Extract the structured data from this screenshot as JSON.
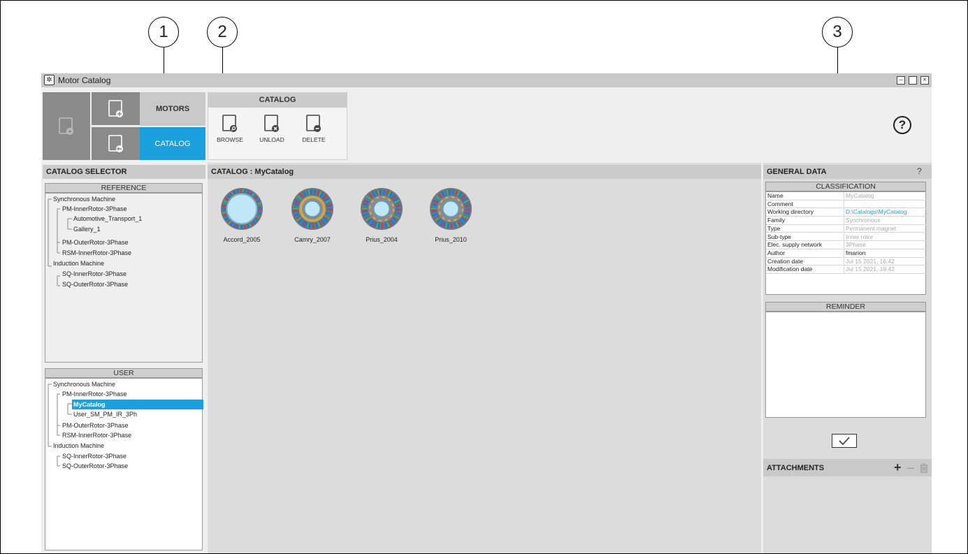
{
  "callouts": [
    "1",
    "2",
    "3"
  ],
  "window": {
    "title": "Motor Catalog",
    "buttons": [
      "minimize",
      "maximize",
      "close"
    ]
  },
  "nav": {
    "motors_label": "MOTORS",
    "catalog_label": "CATALOG"
  },
  "ribbon": {
    "title": "CATALOG",
    "buttons": [
      {
        "label": "BROWSE",
        "icon": "book-browse-icon"
      },
      {
        "label": "UNLOAD",
        "icon": "book-unload-icon"
      },
      {
        "label": "DELETE",
        "icon": "book-delete-icon"
      }
    ]
  },
  "help_icon": "?",
  "catalog_selector": {
    "title": "CATALOG SELECTOR",
    "reference": {
      "title": "REFERENCE",
      "items": [
        "Synchronous Machine",
        "PM-InnerRotor-3Phase",
        "Automotive_Transport_1",
        "Gallery_1",
        "PM-OuterRotor-3Phase",
        "RSM-InnerRotor-3Phase",
        "Induction Machine",
        "SQ-InnerRotor-3Phase",
        "SQ-OuterRotor-3Phase"
      ]
    },
    "user": {
      "title": "USER",
      "items": [
        "Synchronous Machine",
        "PM-InnerRotor-3Phase",
        "MyCatalog",
        "User_SM_PM_IR_3Ph",
        "PM-OuterRotor-3Phase",
        "RSM-InnerRotor-3Phase",
        "Induction Machine",
        "SQ-InnerRotor-3Phase",
        "SQ-OuterRotor-3Phase"
      ],
      "selected": "MyCatalog"
    }
  },
  "catalog": {
    "title": "CATALOG : MyCatalog",
    "motors": [
      "Accord_2005",
      "Camry_2007",
      "Prius_2004",
      "Prius_2010"
    ]
  },
  "general_data": {
    "title": "GENERAL DATA",
    "help": "?",
    "classification_title": "CLASSIFICATION",
    "rows": [
      {
        "key": "Name",
        "value": "MyCatalog"
      },
      {
        "key": "Comment",
        "value": ""
      },
      {
        "key": "Working directory",
        "value": "D:\\Catalogs\\MyCatalog"
      },
      {
        "key": "Family",
        "value": "Synchronous"
      },
      {
        "key": "Type",
        "value": "Permanent magnet"
      },
      {
        "key": "Sub-type",
        "value": "Inner rotor"
      },
      {
        "key": "Elec. supply network",
        "value": "3Phase"
      },
      {
        "key": "Author",
        "value": "fmarion"
      },
      {
        "key": "Creation date",
        "value": "Jul 15 2021, 16:42"
      },
      {
        "key": "Modification date",
        "value": "Jul 15 2021, 18:42"
      }
    ],
    "reminder_title": "REMINDER",
    "reminder_text": ""
  },
  "attachments": {
    "title": "ATTACHMENTS"
  },
  "colors": {
    "accent": "#1aa0dc",
    "panel": "#dcdcdc",
    "header": "#cbcbcb",
    "nav_dark": "#8a8a8a"
  }
}
